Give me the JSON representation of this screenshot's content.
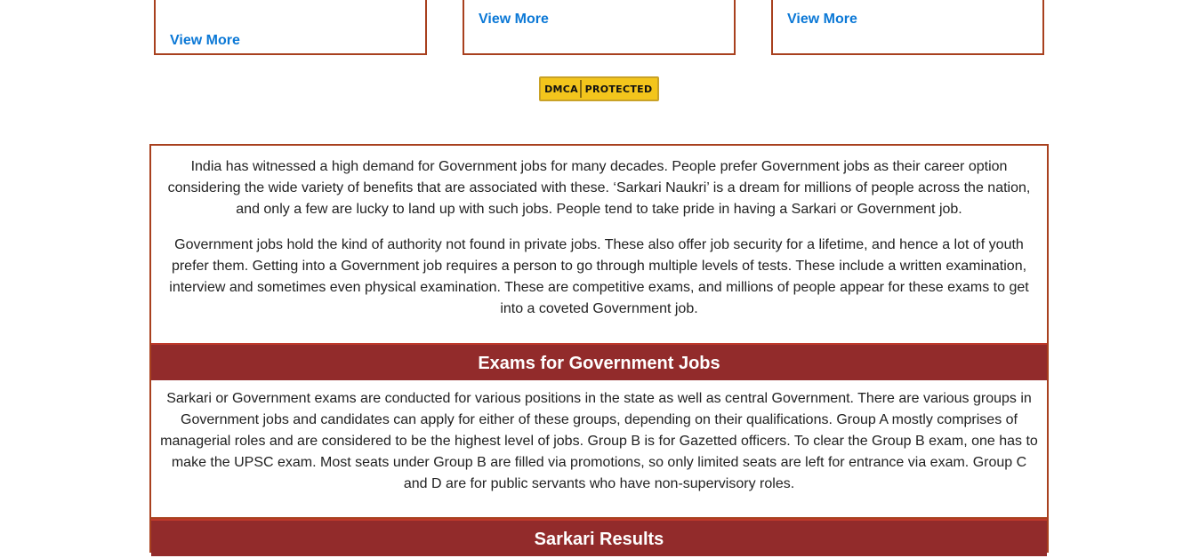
{
  "cards": [
    {
      "link_label": "View More"
    },
    {
      "link_label": "View More"
    },
    {
      "link_label": "View More"
    }
  ],
  "dmca_badge": {
    "left": "DMCA",
    "right": "PROTECTED",
    "color": "#f3c51c"
  },
  "intro": {
    "p1": "India has witnessed a high demand for Government jobs for many decades. People prefer Government jobs as their career option considering the wide variety of benefits that are associated with these. ‘Sarkari Naukri’ is a dream for millions of people across the nation, and only a few are lucky to land up with such jobs. People tend to take pride in having a Sarkari or Government job.",
    "p2": "Government jobs hold the kind of authority not found in private jobs. These also offer job security for a lifetime, and hence a lot of youth prefer them. Getting into a Government job requires a person to go through multiple levels of tests. These include a written examination, interview and sometimes even physical examination. These are competitive exams, and millions of people appear for these exams to get into a coveted Government job."
  },
  "sections": [
    {
      "title": "Exams for Government Jobs",
      "body": "Sarkari or Government exams are conducted for various positions in the state as well as central Government. There are various groups in Government jobs and candidates can apply for either of these groups, depending on their qualifications. Group A mostly comprises of managerial roles and are considered to be the highest level of jobs. Group B is for Gazetted officers. To clear the Group B exam, one has to make the UPSC exam. Most seats under Group B are filled via promotions, so only limited seats are left for entrance via exam. Group C and D are for public servants who have non-supervisory roles."
    },
    {
      "title": "Sarkari Results"
    }
  ],
  "colors": {
    "accent": "#922b2b",
    "border": "#a8401e",
    "link": "#0b78d6"
  }
}
